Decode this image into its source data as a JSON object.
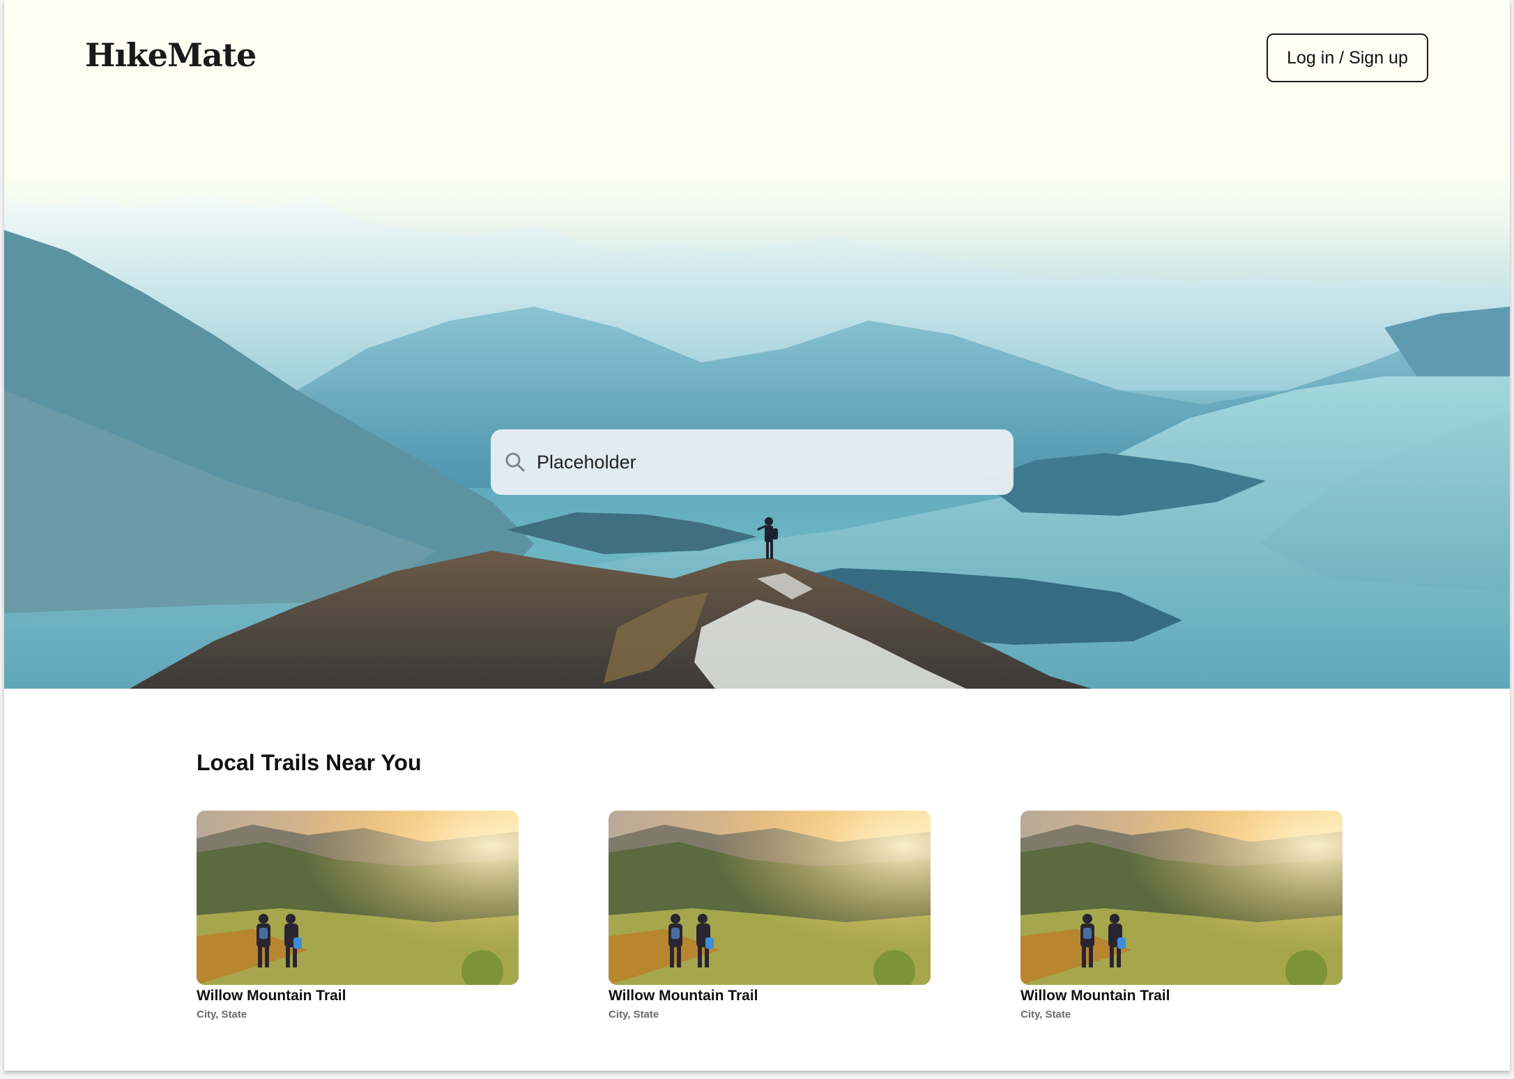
{
  "header": {
    "logo": "HıkeMate",
    "login_label": "Log in / Sign up"
  },
  "search": {
    "placeholder": "Placeholder",
    "icon": "search-icon"
  },
  "trails": {
    "title": "Local Trails Near You",
    "items": [
      {
        "name": "Willow Mountain Trail",
        "location": "City, State"
      },
      {
        "name": "Willow Mountain Trail",
        "location": "City, State"
      },
      {
        "name": "Willow Mountain Trail",
        "location": "City, State"
      }
    ]
  },
  "colors": {
    "text": "#111111",
    "muted": "#6a6a6a",
    "hero_sky": "#fdfff1",
    "lake": "#6db7c4"
  }
}
